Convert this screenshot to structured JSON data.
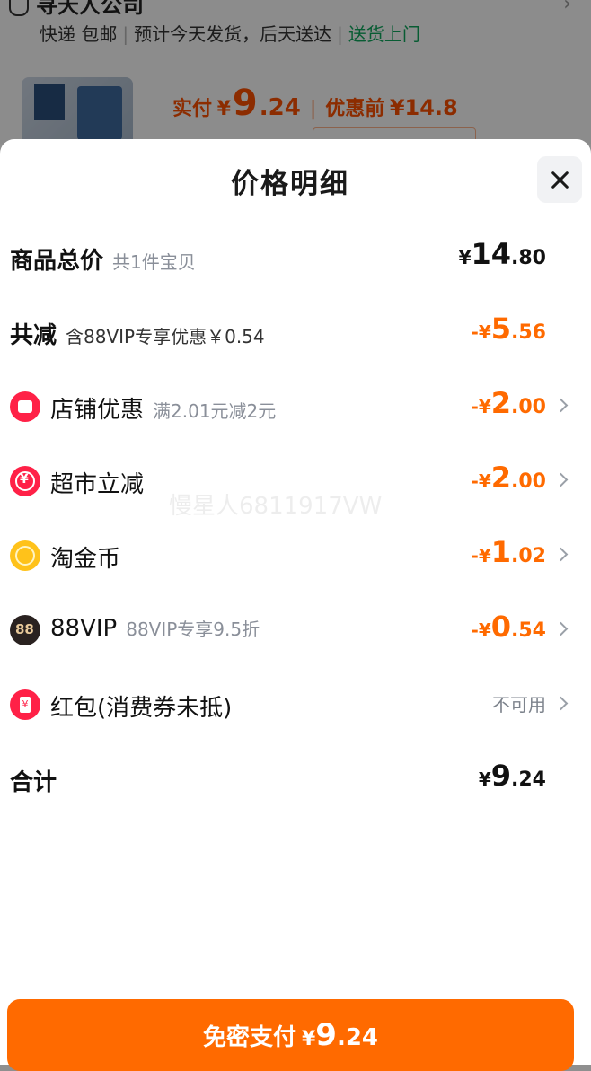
{
  "background": {
    "seller_name": "寻天人公司",
    "shipping": [
      "快递 包邮",
      "预计今天发货，后天送达"
    ],
    "delivery_badge": "送货上门",
    "paid_label": "实付",
    "paid_currency": "¥",
    "paid_int": "9",
    "paid_dec": ".24",
    "before_label": "优惠前",
    "before_price": "¥14.8"
  },
  "sheet": {
    "title": "价格明细",
    "close_icon": "close-icon"
  },
  "rows": [
    {
      "label": "商品总价",
      "sub": "共1件宝贝",
      "currency": "¥",
      "int": "14",
      "dec": ".80",
      "style": "black"
    },
    {
      "label": "共减",
      "sub": "含88VIP专享优惠￥0.54",
      "currency": "-¥",
      "int": "5",
      "dec": ".56",
      "style": "orange"
    },
    {
      "label": "店铺优惠",
      "sub": "满2.01元减2元",
      "currency": "-¥",
      "int": "2",
      "dec": ".00",
      "style": "orange",
      "icon": "shop-icon"
    },
    {
      "label": "超市立减",
      "sub": "",
      "currency": "-¥",
      "int": "2",
      "dec": ".00",
      "style": "orange",
      "icon": "supermarket-icon"
    },
    {
      "label": "淘金币",
      "sub": "",
      "currency": "-¥",
      "int": "1",
      "dec": ".02",
      "style": "orange",
      "icon": "coin-icon"
    },
    {
      "label": "88VIP",
      "sub": "88VIP专享9.5折",
      "currency": "-¥",
      "int": "0",
      "dec": ".54",
      "style": "orange",
      "icon": "vip-icon"
    },
    {
      "label": "红包(消费券未抵)",
      "sub": "",
      "status": "不可用",
      "icon": "red-packet-icon"
    },
    {
      "label": "合计",
      "sub": "",
      "currency": "¥",
      "int": "9",
      "dec": ".24",
      "style": "black"
    }
  ],
  "watermark": "慢星人6811917VW",
  "pay_button": {
    "label": "免密支付",
    "currency": "¥",
    "int": "9",
    "dec": ".24"
  },
  "colors": {
    "accent": "#ff6a00",
    "discount": "#ff6a00",
    "delivery": "#0fa85e",
    "icon_red": "#ff2147",
    "coin": "#ffc21a"
  }
}
